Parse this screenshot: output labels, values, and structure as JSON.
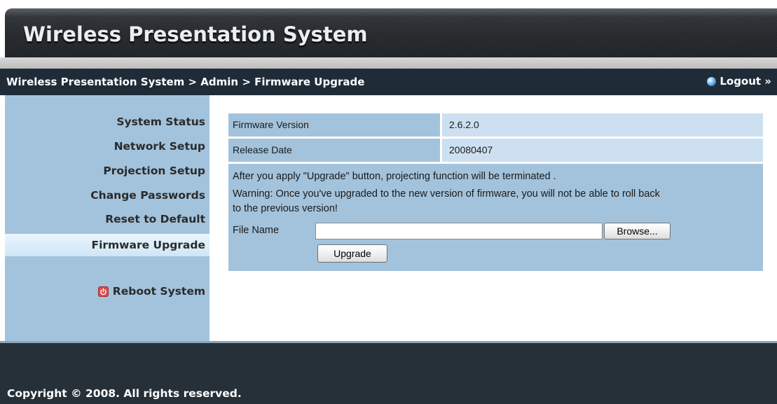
{
  "header": {
    "title": "Wireless Presentation System"
  },
  "breadcrumb": {
    "text": "Wireless Presentation System > Admin > Firmware Upgrade",
    "logout_label": "Logout »"
  },
  "sidebar": {
    "items": [
      {
        "label": "System Status",
        "active": false
      },
      {
        "label": "Network Setup",
        "active": false
      },
      {
        "label": "Projection Setup",
        "active": false
      },
      {
        "label": "Change Passwords",
        "active": false
      },
      {
        "label": "Reset to Default",
        "active": false
      },
      {
        "label": "Firmware Upgrade",
        "active": true
      }
    ],
    "reboot_label": "Reboot System"
  },
  "firmware": {
    "version_label": "Firmware Version",
    "version_value": "2.6.2.0",
    "release_label": "Release Date",
    "release_value": "20080407"
  },
  "upgrade": {
    "note1": "After you apply \"Upgrade\" button, projecting function will be terminated .",
    "note2": "Warning: Once you've upgraded to the new version of firmware, you will not be able to roll back",
    "note3": "to the previous version!",
    "file_label": "File Name",
    "file_value": "",
    "browse_label": "Browse...",
    "upgrade_label": "Upgrade"
  },
  "footer": {
    "copyright": "Copyright © 2008. All rights reserved."
  },
  "colors": {
    "sidebar_bg": "#a3c3dc",
    "value_bg": "#cde0f1",
    "breadcrumb_bg": "#1f2c38",
    "footer_bg": "#263038",
    "reboot_icon": "#d94b4b"
  },
  "icons": {
    "logout": "blue-orb-icon",
    "reboot": "power-icon"
  }
}
